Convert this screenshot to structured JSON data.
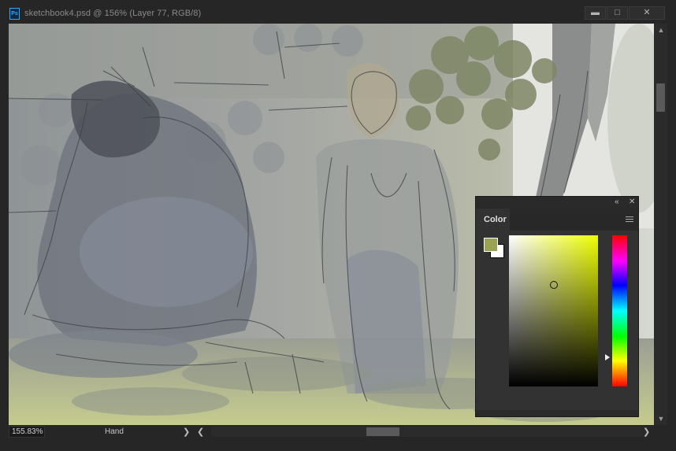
{
  "window": {
    "app_icon": "Ps",
    "title": "sketchbook4.psd @ 156% (Layer 77, RGB/8)",
    "controls": {
      "minimize": "minimize-icon",
      "maximize": "maximize-icon",
      "close": "close-icon"
    }
  },
  "status": {
    "zoom_value": "155.83%",
    "tool_name": "Hand"
  },
  "color_panel": {
    "tab_label": "Color",
    "foreground_color": "#9aa351",
    "background_color": "#ffffff",
    "hue_color": "#eeff00"
  },
  "colors": {
    "accent": "#31a8ff",
    "chrome": "#262626",
    "panel": "#323232"
  }
}
